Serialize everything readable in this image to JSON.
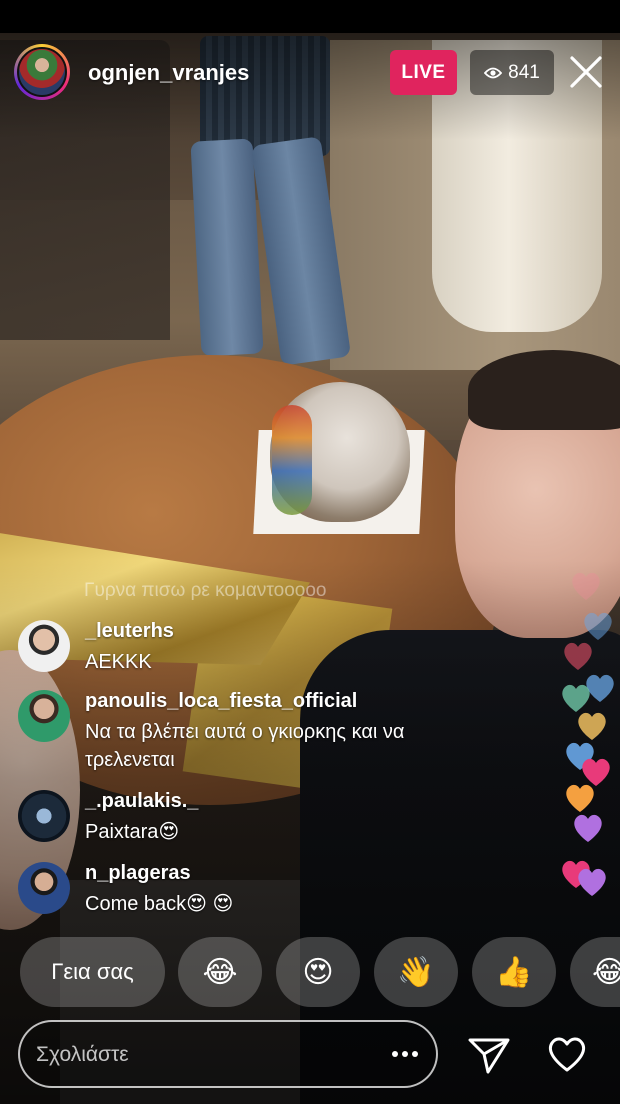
{
  "header": {
    "username": "ognjen_vranjes",
    "live_label": "LIVE",
    "viewer_count": "841",
    "close_icon": "close-icon",
    "eye_icon": "eye-icon"
  },
  "colors": {
    "live_badge": "#e0245e",
    "avatar_ring": [
      "#f9ce34",
      "#ee2a7b",
      "#6228d7"
    ]
  },
  "faded_comment": "Γυρνα πισω ρε κομαντοοοοο",
  "comments": [
    {
      "user": "_leuterhs",
      "text": "AEKKK"
    },
    {
      "user": "panoulis_loca_fiesta_official",
      "text": "Να τα βλέπει αυτά ο γκιορκης και να τρελενεται"
    },
    {
      "user": "_.paulakis._",
      "text": "Paixtara😍"
    },
    {
      "user": "n_plageras",
      "text": "Come back😍 😍"
    }
  ],
  "quick_replies": [
    {
      "label": "Γεια σας"
    },
    {
      "label": "😂"
    },
    {
      "label": "😍"
    },
    {
      "label": "👋"
    },
    {
      "label": "👍"
    },
    {
      "label": "😂"
    }
  ],
  "comment_bar": {
    "placeholder": "Σχολιάστε",
    "more_icon": "more-options-icon",
    "send_icon": "send-icon",
    "like_icon": "heart-icon"
  },
  "reaction_hearts": [
    "#e83a7a",
    "#f08a9a",
    "#6aa8e8",
    "#f0c060",
    "#b070e0",
    "#e8506a",
    "#70c8a8",
    "#f4a040"
  ]
}
